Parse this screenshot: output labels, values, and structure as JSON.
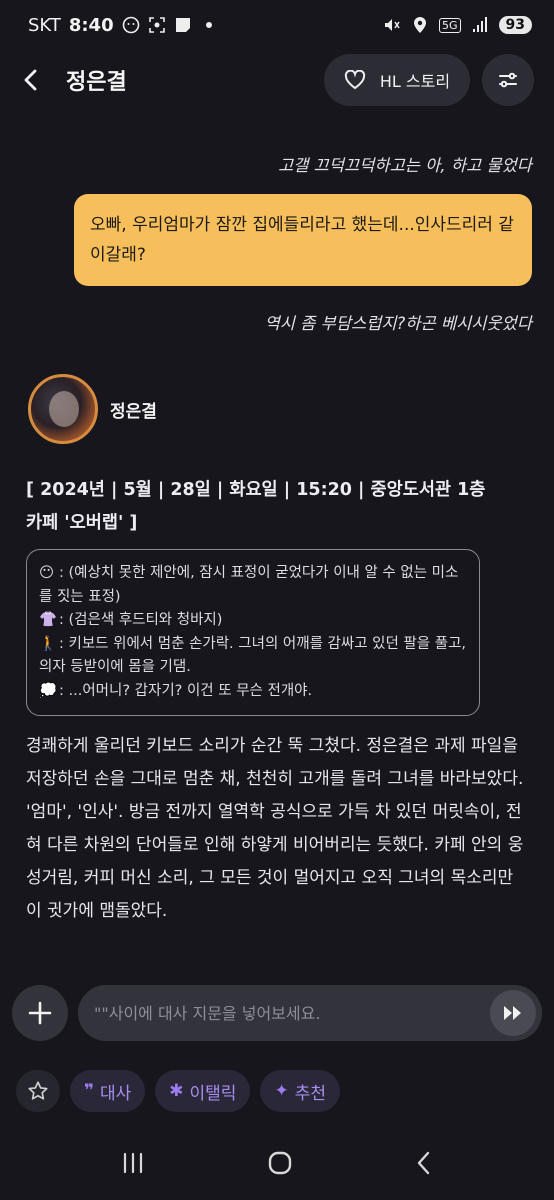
{
  "status_bar": {
    "carrier": "SKT",
    "time": "8:40",
    "network": "5G",
    "battery": "93"
  },
  "header": {
    "title": "정은결",
    "story_button": "HL 스토리"
  },
  "chat": {
    "narration_top": "고갤 끄덕끄덕하고는 아, 하고 물었다",
    "user_message": "오빠, 우리엄마가 잠깐 집에들리라고 했는데...인사드리러 같이갈래?",
    "narration_after": "역시 좀 부담스럽지?하곤 베시시웃었다",
    "character_name": "정은결",
    "scene_header": "[ 2024년 | 5월 | 28일 | 화요일 | 15:20 | 중앙도서관 1층 카페 '오버랩' ]",
    "status_lines": [
      {
        "emoji": "😶",
        "text": ": (예상치 못한 제안에, 잠시 표정이 굳었다가 이내 알 수 없는 미소를 짓는 표정)"
      },
      {
        "emoji": "👚",
        "text": ": (검은색 후드티와 청바지)"
      },
      {
        "emoji": "🚶",
        "text": ": 키보드 위에서 멈춘 손가락. 그녀의 어깨를 감싸고 있던 팔을 풀고, 의자 등받이에 몸을 기댐."
      },
      {
        "emoji": "💭",
        "text": ": ...어머니? 갑자기? 이건 또 무슨 전개야."
      }
    ],
    "narration_body": "경쾌하게 울리던 키보드 소리가 순간 뚝 그쳤다. 정은결은 과제 파일을 저장하던 손을 그대로 멈춘 채, 천천히 고개를 돌려 그녀를 바라보았다. '엄마', '인사'. 방금 전까지 열역학 공식으로 가득 차 있던 머릿속이, 전혀 다른 차원의 단어들로 인해 하얗게 비어버리는 듯했다. 카페 안의 웅성거림, 커피 머신 소리, 그 모든 것이 멀어지고 오직 그녀의 목소리만이 귓가에 맴돌았다."
  },
  "input": {
    "placeholder": "\"\"사이에 대사 지문을 넣어보세요.",
    "value": ""
  },
  "toolbar": {
    "dialogue": "대사",
    "italic": "이탤릭",
    "recommend": "추천"
  },
  "colors": {
    "user_bubble": "#f7bf5c",
    "background": "#16161c",
    "chip_text": "#a88ef0"
  }
}
